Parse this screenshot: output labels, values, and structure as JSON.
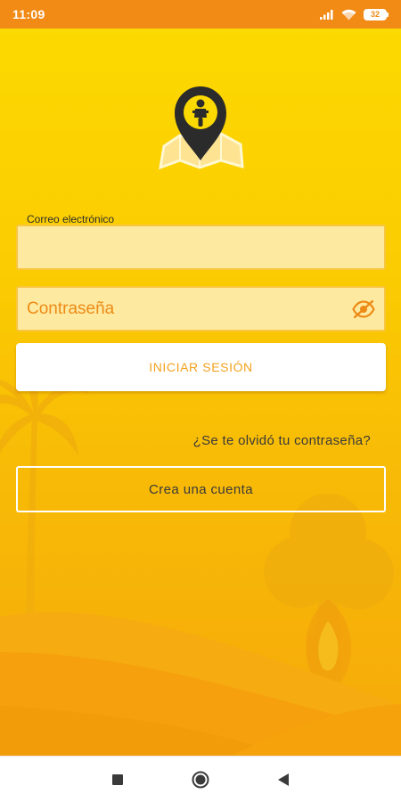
{
  "status_bar": {
    "time": "11:09",
    "battery_level": "32",
    "icons": [
      "signal-icon",
      "wifi-icon",
      "battery-icon"
    ]
  },
  "login": {
    "email_label": "Correo electrónico",
    "email_value": "",
    "password_placeholder": "Contraseña",
    "password_value": "",
    "login_button": "INICIAR SESIÓN",
    "forgot_password": "¿Se te olvidó tu contraseña?",
    "create_account": "Crea una cuenta"
  },
  "nav_bar": {
    "buttons": [
      "recent-apps-icon",
      "home-icon",
      "back-icon"
    ]
  },
  "colors": {
    "status_bar": "#f28a16",
    "background_top": "#fcd900",
    "background_bottom": "#f6a90a",
    "field_fill": "#fdeaa0",
    "accent_orange": "#ee8a16",
    "logo_dark": "#2b2b2b"
  }
}
